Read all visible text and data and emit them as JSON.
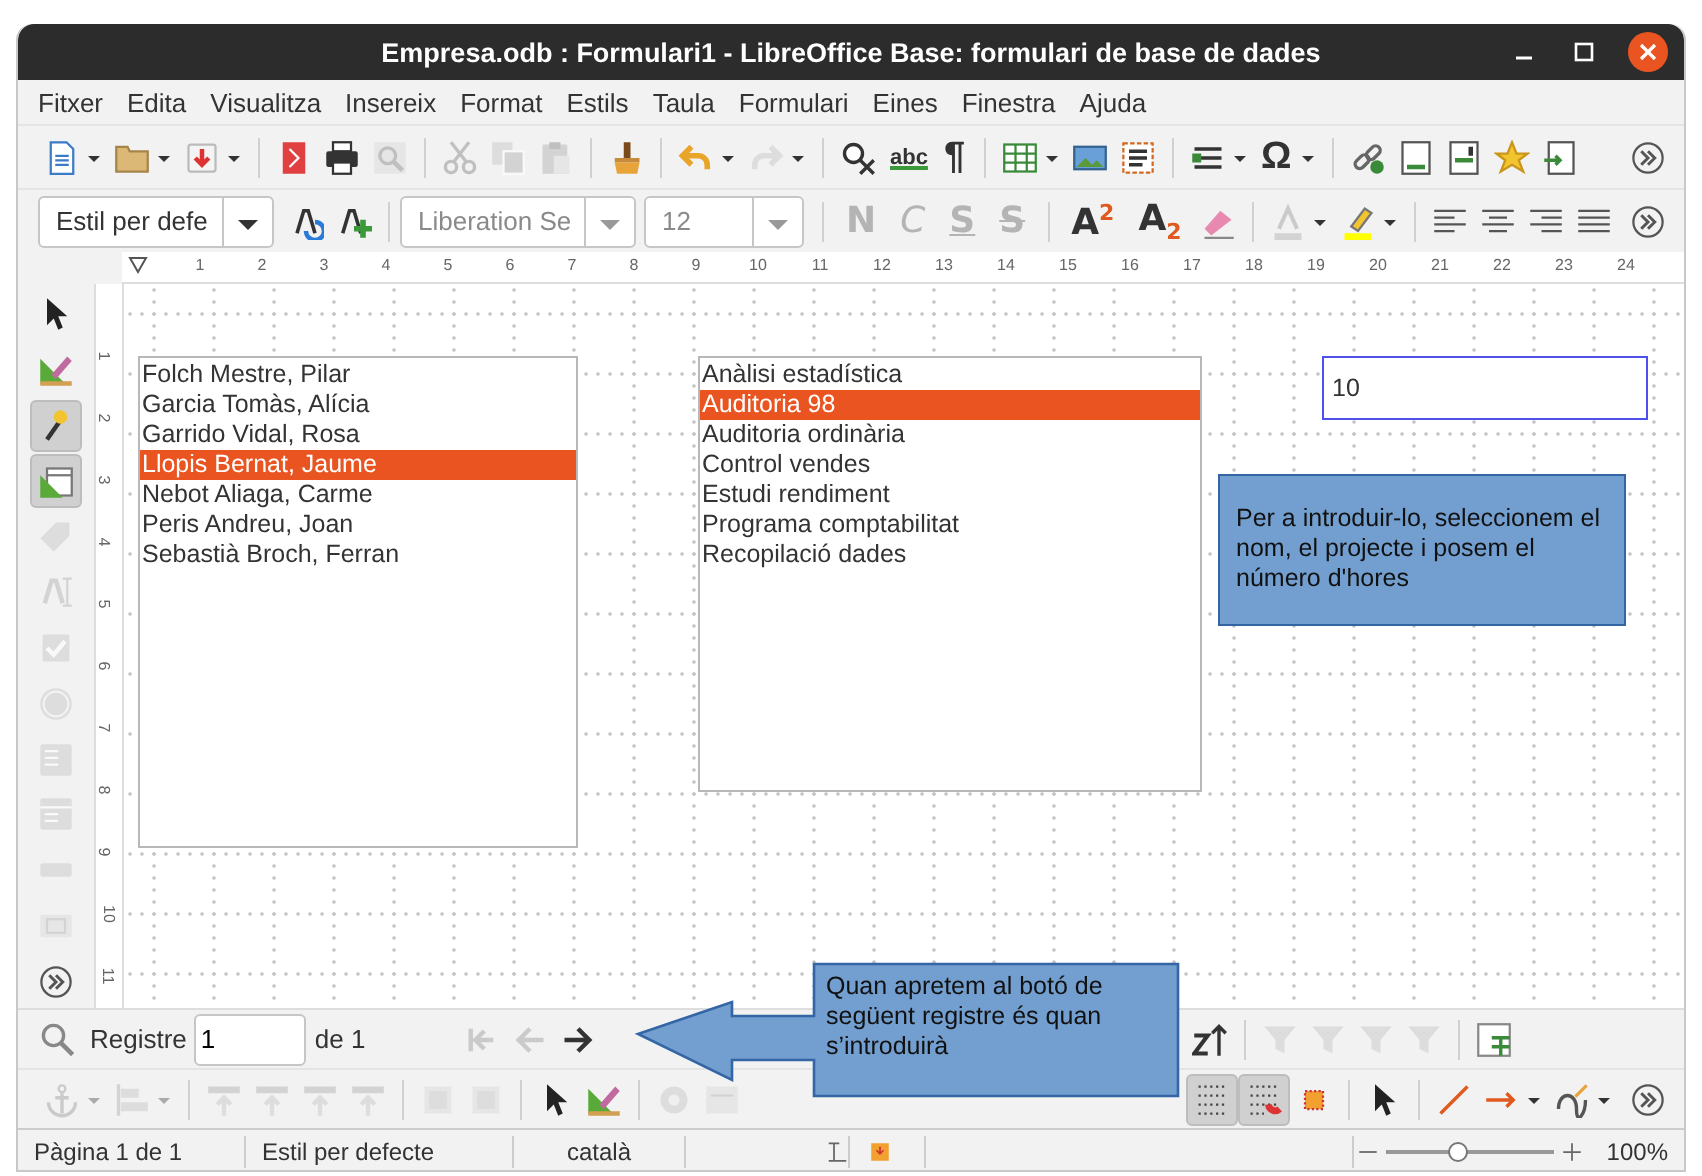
{
  "window": {
    "title": "Empresa.odb : Formulari1 - LibreOffice Base: formulari de base de dades"
  },
  "menu": [
    "Fitxer",
    "Edita",
    "Visualitza",
    "Insereix",
    "Format",
    "Estils",
    "Taula",
    "Formulari",
    "Eines",
    "Finestra",
    "Ajuda"
  ],
  "standard_toolbar": {
    "glyphs": [
      "abc",
      "¶",
      "Ω"
    ]
  },
  "formatting_toolbar": {
    "paragraph_style": "Estil per defe",
    "font_name": {
      "value": "Liberation Se",
      "disabled": true
    },
    "font_size": {
      "value": "12",
      "disabled": true
    },
    "buttons": [
      {
        "glyph": "N",
        "kind": "bold",
        "disabled": true
      },
      {
        "glyph": "C",
        "kind": "italic",
        "disabled": true
      },
      {
        "glyph": "S",
        "kind": "underline",
        "disabled": true
      },
      {
        "glyph": "S",
        "kind": "strike",
        "disabled": true
      },
      {
        "glyph": "A$^{2}$",
        "kind": "superscript",
        "disabled": false
      },
      {
        "glyph": "A$_{2}$",
        "kind": "subscript",
        "disabled": false
      }
    ]
  },
  "ruler": {
    "horizontal": [
      "1",
      "2",
      "3",
      "4",
      "5",
      "6",
      "7",
      "8",
      "9",
      "10",
      "11",
      "12",
      "13",
      "14",
      "15",
      "16",
      "17",
      "18",
      "19",
      "20",
      "21",
      "22",
      "23",
      "24"
    ],
    "vertical": [
      "1",
      "2",
      "3",
      "4",
      "5",
      "6",
      "7",
      "8",
      "9",
      "10",
      "11"
    ]
  },
  "form_controls_toolbar": {
    "wizards_on": true,
    "design_on": true
  },
  "form": {
    "names_list": [
      {
        "label": "Folch Mestre, Pilar",
        "selected": false
      },
      {
        "label": "Garcia Tomàs, Alícia",
        "selected": false
      },
      {
        "label": "Garrido Vidal, Rosa",
        "selected": false
      },
      {
        "label": "Llopis Bernat, Jaume",
        "selected": true
      },
      {
        "label": "Nebot Aliaga, Carme",
        "selected": false
      },
      {
        "label": "Peris Andreu, Joan",
        "selected": false
      },
      {
        "label": "Sebastià Broch, Ferran",
        "selected": false
      }
    ],
    "projects_list": [
      {
        "label": "Anàlisi estadística",
        "selected": false
      },
      {
        "label": "Auditoria 98",
        "selected": true
      },
      {
        "label": "Auditoria ordinària",
        "selected": false
      },
      {
        "label": "Control vendes",
        "selected": false
      },
      {
        "label": "Estudi rendiment",
        "selected": false
      },
      {
        "label": "Programa comptabilitat",
        "selected": false
      },
      {
        "label": "Recopilació dades",
        "selected": false
      }
    ],
    "hours_field": {
      "value": "10"
    },
    "note": "Per a introduir-lo, seleccionem el nom, el projecte i posem el número d'hores"
  },
  "navigation_bar": {
    "label": "Registre",
    "record": "1",
    "total": "de 1"
  },
  "callout": "Quan apretem al botó de següent registre és quan s’introduirà",
  "bottom_toolbar": {
    "grid_on": true,
    "snap_on": true
  },
  "status_bar": {
    "page": "Pàgina 1 de 1",
    "style": "Estil per defecte",
    "language": "català",
    "zoom": {
      "level": 0.42,
      "reading": "100%"
    }
  }
}
